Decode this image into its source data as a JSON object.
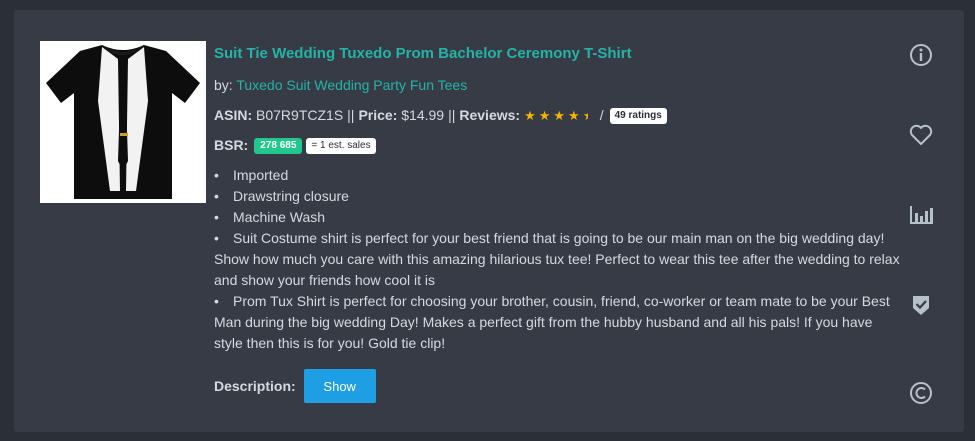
{
  "product": {
    "title": "Suit Tie Wedding Tuxedo Prom Bachelor Ceremony T-Shirt",
    "by_label": "by:",
    "brand": "Tuxedo Suit Wedding Party Fun Tees",
    "asin_label": "ASIN:",
    "asin": "B07R9TCZ1S",
    "separator": "||",
    "price_label": "Price:",
    "price": "$14.99",
    "reviews_label": "Reviews:",
    "rating": 4.5,
    "rating_slash": "/",
    "ratings_count": "49 ratings",
    "bsr_label": "BSR:",
    "bsr_value": "278 685",
    "est_sales": "= 1 est. sales",
    "bullet": "•",
    "features": [
      "Imported",
      "Drawstring closure",
      "Machine Wash",
      "Suit Costume shirt is perfect for your best friend that is going to be our main man on the big wedding day! Show how much you care with this amazing hilarious tux tee! Perfect to wear this tee after the wedding to relax and show your friends how cool it is",
      "Prom Tux Shirt is perfect for choosing your brother, cousin, friend, co-worker or team mate to be your Best Man during the big wedding Day! Makes a perfect gift from the hubby husband and all his pals! If you have style then this is for you! Gold tie clip!"
    ],
    "description_label": "Description:",
    "show_button": "Show"
  },
  "side_icons": [
    "info-icon",
    "heart-icon",
    "bar-chart-icon",
    "shield-check-icon",
    "copyright-icon"
  ],
  "colors": {
    "background": "#2b2f38",
    "card": "#363b46",
    "accent": "#25b3a7",
    "star": "#f5b500",
    "bsr_badge": "#22c78e",
    "button": "#1e9ee3"
  }
}
